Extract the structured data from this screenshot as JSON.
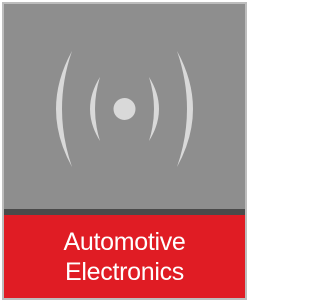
{
  "tile": {
    "icon": "signal-broadcast-icon",
    "label_line1": "Automotive",
    "label_line2": "Electronics",
    "colors": {
      "top_background": "#8e8e8e",
      "divider": "#4a4a4a",
      "label_background": "#e01c24",
      "icon": "#d9d9d9",
      "label_text": "#ffffff",
      "border": "#bdbdbd"
    }
  }
}
